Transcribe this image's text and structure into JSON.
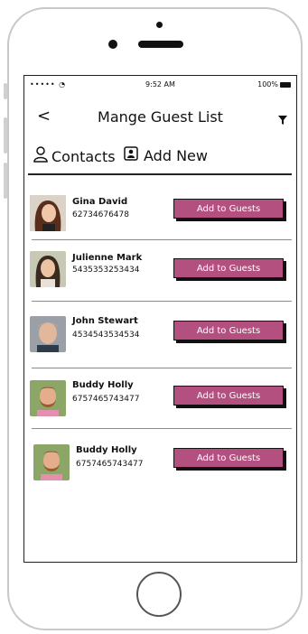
{
  "status_bar": {
    "signal": "••••• ",
    "time": "9:52 AM",
    "battery": "100%"
  },
  "header": {
    "back": "<",
    "title": "Mange Guest List"
  },
  "tabs": [
    {
      "label": "Contacts",
      "icon": "person-outline-icon"
    },
    {
      "label": "Add New",
      "icon": "contact-card-icon"
    }
  ],
  "contacts": [
    {
      "name": "Gina David",
      "phone": "62734676478",
      "button": "Add to Guests"
    },
    {
      "name": "Julienne Mark",
      "phone": "5435353253434",
      "button": "Add to Guests"
    },
    {
      "name": "John Stewart",
      "phone": "4534543534534",
      "button": "Add to Guests"
    },
    {
      "name": "Buddy Holly",
      "phone": "6757465743477",
      "button": "Add to Guests"
    },
    {
      "name": "Buddy Holly",
      "phone": "6757465743477",
      "button": "Add to Guests"
    }
  ],
  "colors": {
    "accent": "#b3507f"
  }
}
